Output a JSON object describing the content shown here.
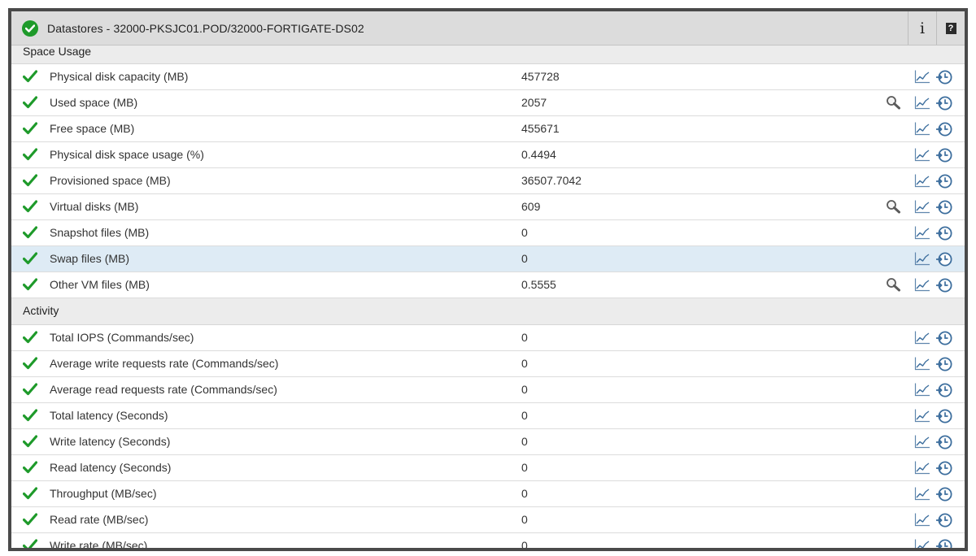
{
  "header": {
    "title": "Datastores - 32000-PKSJC01.POD/32000-FORTIGATE-DS02",
    "info_label": "i",
    "help_label": "?"
  },
  "sections": [
    {
      "title": "Space Usage",
      "rows": [
        {
          "label": "Physical disk capacity (MB)",
          "value": "457728",
          "search": false
        },
        {
          "label": "Used space (MB)",
          "value": "2057",
          "search": true
        },
        {
          "label": "Free space (MB)",
          "value": "455671",
          "search": false
        },
        {
          "label": "Physical disk space usage (%)",
          "value": "0.4494",
          "search": false
        },
        {
          "label": "Provisioned space (MB)",
          "value": "36507.7042",
          "search": false
        },
        {
          "label": "Virtual disks (MB)",
          "value": "609",
          "search": true
        },
        {
          "label": "Snapshot files (MB)",
          "value": "0",
          "search": false
        },
        {
          "label": "Swap files (MB)",
          "value": "0",
          "search": false,
          "highlighted": true
        },
        {
          "label": "Other VM files (MB)",
          "value": "0.5555",
          "search": true
        }
      ]
    },
    {
      "title": "Activity",
      "rows": [
        {
          "label": "Total IOPS (Commands/sec)",
          "value": "0",
          "search": false
        },
        {
          "label": "Average write requests rate (Commands/sec)",
          "value": "0",
          "search": false
        },
        {
          "label": "Average read requests rate (Commands/sec)",
          "value": "0",
          "search": false
        },
        {
          "label": "Total latency (Seconds)",
          "value": "0",
          "search": false
        },
        {
          "label": "Write latency (Seconds)",
          "value": "0",
          "search": false
        },
        {
          "label": "Read latency (Seconds)",
          "value": "0",
          "search": false
        },
        {
          "label": "Throughput (MB/sec)",
          "value": "0",
          "search": false
        },
        {
          "label": "Read rate (MB/sec)",
          "value": "0",
          "search": false
        },
        {
          "label": "Write rate (MB/sec)",
          "value": "0",
          "search": false
        }
      ]
    }
  ],
  "icons": {
    "status": "check-icon",
    "search": "magnifier-icon",
    "graph": "line-chart-icon",
    "history": "history-clock-icon"
  },
  "colors": {
    "ok_green": "#1e9a2a",
    "header_bg": "#dcdcdc",
    "section_bg": "#ececec",
    "highlight_row": "#deebf5",
    "icon_blue": "#3e6f9e"
  }
}
